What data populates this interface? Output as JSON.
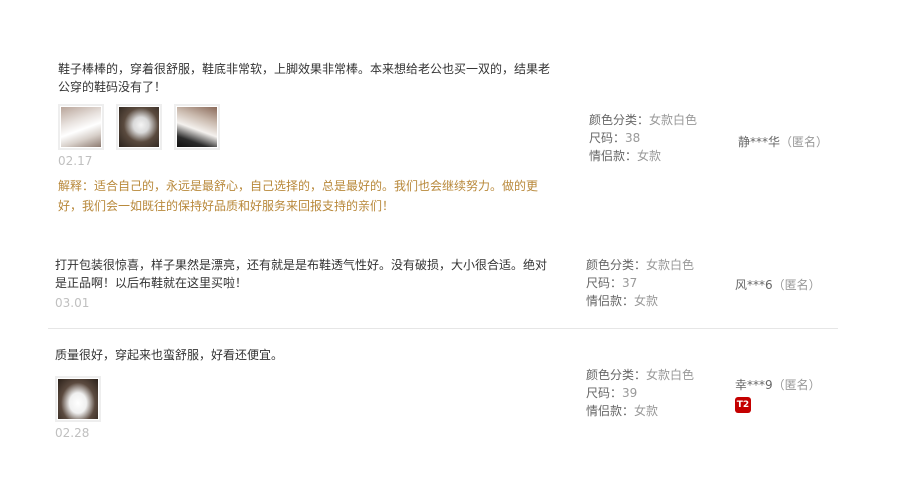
{
  "reviews": [
    {
      "text": "鞋子棒棒的，穿着很舒服，鞋底非常软，上脚效果非常棒。本来想给老公也买一双的，结果老公穿的鞋码没有了！",
      "date": "02.17",
      "reply": "解释：适合自己的，永远是最舒心，自己选择的，总是最好的。我们也会继续努力。做的更好，我们会一如既往的保持好品质和好服务来回报支持的亲们！",
      "images": [
        "shoe-photo-1",
        "shoe-photo-2",
        "shoe-photo-3"
      ],
      "attrs": {
        "color_label": "颜色分类：",
        "color_value": "女款白色",
        "size_label": "尺码：",
        "size_value": "38",
        "couple_label": "情侣款：",
        "couple_value": "女款"
      },
      "user": {
        "name": "静***华",
        "anon": "（匿名）"
      }
    },
    {
      "text": "打开包装很惊喜，样子果然是漂亮，还有就是是布鞋透气性好。没有破损，大小很合适。绝对是正品啊！以后布鞋就在这里买啦！",
      "date": "03.01",
      "attrs": {
        "color_label": "颜色分类：",
        "color_value": "女款白色",
        "size_label": "尺码：",
        "size_value": "37",
        "couple_label": "情侣款：",
        "couple_value": "女款"
      },
      "user": {
        "name": "风***6",
        "anon": "（匿名）"
      }
    },
    {
      "text": "质量很好，穿起来也蛮舒服，好看还便宜。",
      "date": "02.28",
      "images": [
        "shoe-photo-4"
      ],
      "attrs": {
        "color_label": "颜色分类：",
        "color_value": "女款白色",
        "size_label": "尺码：",
        "size_value": "39",
        "couple_label": "情侣款：",
        "couple_value": "女款"
      },
      "user": {
        "name": "幸***9",
        "anon": "（匿名）",
        "badge": "T2"
      }
    }
  ]
}
